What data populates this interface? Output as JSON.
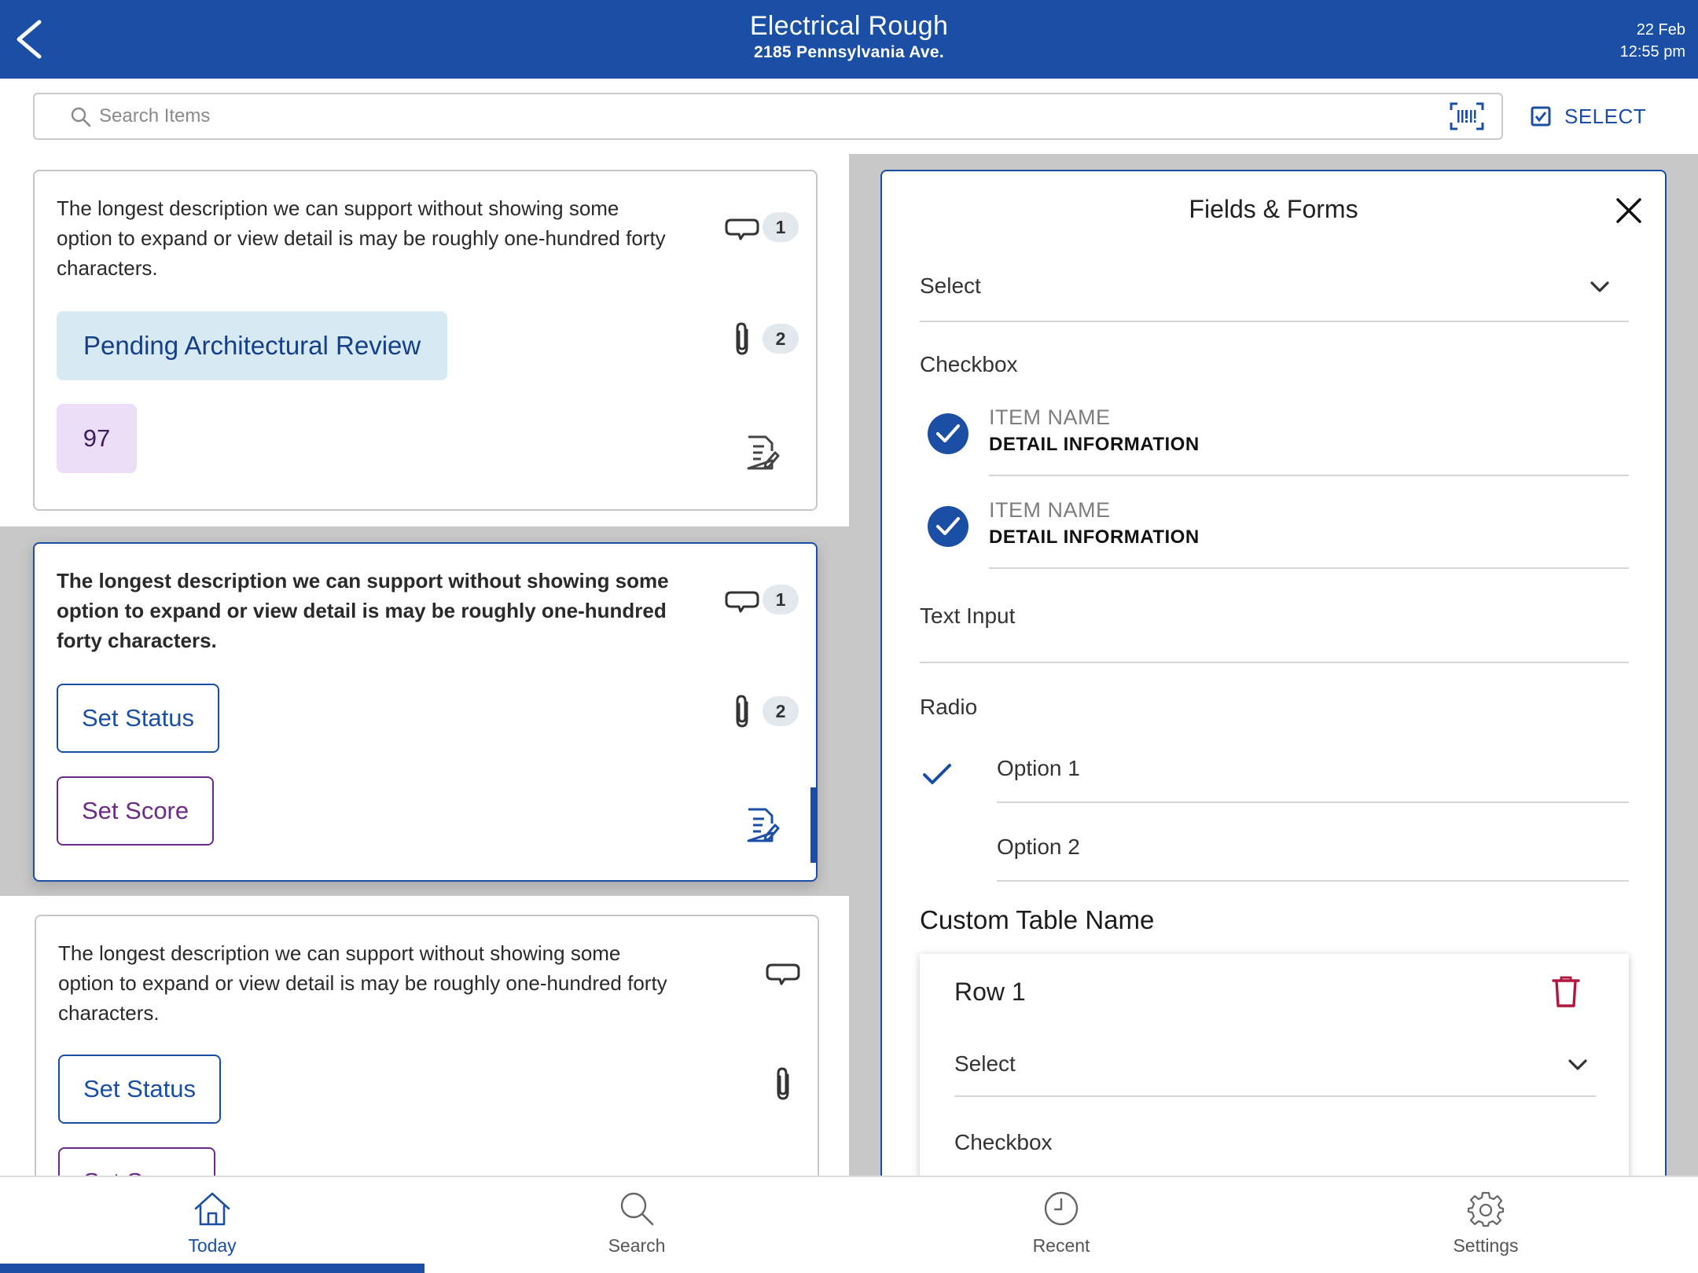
{
  "header": {
    "title": "Electrical Rough",
    "subtitle": "2185 Pennsylvania Ave.",
    "date": "22 Feb",
    "time": "12:55 pm"
  },
  "search": {
    "placeholder": "Search Items",
    "select_label": "SELECT"
  },
  "cards": [
    {
      "description": "The longest description we can support without showing some option to expand or view detail is may be roughly one-hundred forty characters.",
      "status": "Pending Architectural Review",
      "score": "97",
      "comment_count": "1",
      "attachment_count": "2"
    },
    {
      "description": "The longest description we can support without showing some option to expand or view detail is may be roughly one-hundred forty characters.",
      "set_status_label": "Set Status",
      "set_score_label": "Set Score",
      "comment_count": "1",
      "attachment_count": "2"
    },
    {
      "description": "The longest description we can support without showing some option to expand or view detail is may be roughly one-hundred forty characters.",
      "set_status_label": "Set Status",
      "set_score_label": "Set Score"
    }
  ],
  "panel": {
    "title": "Fields & Forms",
    "select_label": "Select",
    "checkbox_label": "Checkbox",
    "checkbox_items": [
      {
        "name": "ITEM NAME",
        "detail": "DETAIL INFORMATION",
        "checked": true
      },
      {
        "name": "ITEM NAME",
        "detail": "DETAIL INFORMATION",
        "checked": true
      }
    ],
    "text_input_label": "Text Input",
    "radio_label": "Radio",
    "radio_options": [
      {
        "label": "Option 1",
        "selected": true
      },
      {
        "label": "Option 2",
        "selected": false
      }
    ],
    "table": {
      "name": "Custom Table Name",
      "row_title": "Row 1",
      "select_label": "Select",
      "checkbox_label": "Checkbox"
    }
  },
  "nav": [
    {
      "label": "Today",
      "icon": "home-icon",
      "active": true
    },
    {
      "label": "Search",
      "icon": "search-icon",
      "active": false
    },
    {
      "label": "Recent",
      "icon": "clock-icon",
      "active": false
    },
    {
      "label": "Settings",
      "icon": "gear-icon",
      "active": false
    }
  ],
  "colors": {
    "primary": "#1a4fa5",
    "status_chip_bg": "#d7eaf3",
    "score_chip_bg": "#ecdef7",
    "score_accent": "#6b2b86",
    "delete": "#b3173f"
  }
}
